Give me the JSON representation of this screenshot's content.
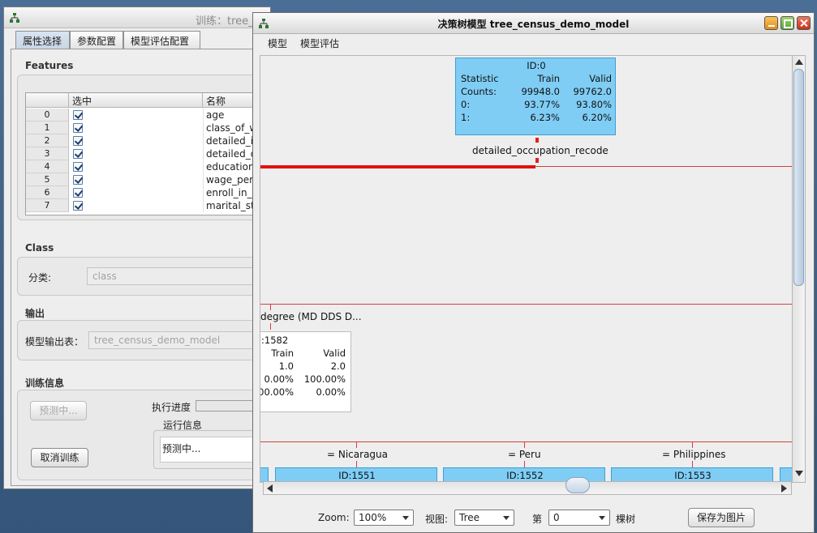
{
  "train_window": {
    "title": "训练：tree_",
    "tabs": [
      "属性选择",
      "参数配置",
      "模型评估配置"
    ],
    "features_label": "Features",
    "table_headers": [
      "选中",
      "名称"
    ],
    "features": [
      {
        "idx": "0",
        "name": "age"
      },
      {
        "idx": "1",
        "name": "class_of_w"
      },
      {
        "idx": "2",
        "name": "detailed_in"
      },
      {
        "idx": "3",
        "name": "detailed_o"
      },
      {
        "idx": "4",
        "name": "education"
      },
      {
        "idx": "5",
        "name": "wage_per_"
      },
      {
        "idx": "6",
        "name": "enroll_in_e"
      },
      {
        "idx": "7",
        "name": "marital_sta"
      }
    ],
    "class_label": "Class",
    "classify_label": "分类:",
    "classify_value": "class",
    "output_label": "输出",
    "model_output_label": "模型输出表：",
    "model_output_value": "tree_census_demo_model",
    "train_info_label": "训练信息",
    "predicting_button": "预测中...",
    "progress_label": "执行进度",
    "run_info_label": "运行信息",
    "run_info_text": "预测中...",
    "cancel_button": "取消训练"
  },
  "tree_window": {
    "title": "决策树模型 tree_census_demo_model",
    "menu": [
      "模型",
      "模型评估"
    ],
    "root_node": {
      "id": "ID:0",
      "header": [
        "Statistic",
        "Train",
        "Valid"
      ],
      "rows": [
        [
          "Counts:",
          "99948.0",
          "99762.0"
        ],
        [
          "0:",
          "93.77%",
          "93.80%"
        ],
        [
          "1:",
          "6.23%",
          "6.20%"
        ]
      ],
      "split": "detailed_occupation_recode"
    },
    "mid_node": {
      "split_label": "degree (MD DDS D...",
      "id": ":1582",
      "header": [
        "Train",
        "Valid"
      ],
      "rows": [
        [
          "1.0",
          "2.0"
        ],
        [
          "0.00%",
          "100.00%"
        ],
        [
          "00.00%",
          "0.00%"
        ]
      ]
    },
    "branches": [
      {
        "label": "=  Nicaragua",
        "id": "ID:1551"
      },
      {
        "label": "=  Peru",
        "id": "ID:1552"
      },
      {
        "label": "=  Philippines",
        "id": "ID:1553"
      }
    ],
    "zoom_label": "Zoom:",
    "zoom_value": "100%",
    "view_label": "视图:",
    "view_value": "Tree",
    "tree_index_prefix": "第",
    "tree_index_value": "0",
    "tree_index_suffix": "棵树",
    "save_button": "保存为图片"
  }
}
